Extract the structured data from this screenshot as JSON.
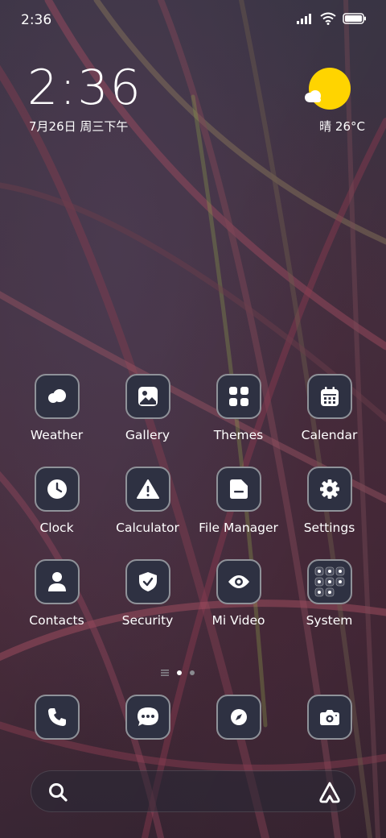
{
  "status_bar": {
    "time": "2:36",
    "icons": [
      "signal-icon",
      "wifi-icon",
      "battery-icon"
    ]
  },
  "lock_widget": {
    "big_time": "2:36",
    "date": "7月26日 周三下午"
  },
  "weather_widget": {
    "text": "晴 26°C",
    "icon": "sun-cloud-icon",
    "sun_color": "#ffd400"
  },
  "apps": [
    {
      "label": "Weather",
      "icon": "weather-cloud-icon"
    },
    {
      "label": "Gallery",
      "icon": "gallery-icon"
    },
    {
      "label": "Themes",
      "icon": "themes-grid-icon"
    },
    {
      "label": "Calendar",
      "icon": "calendar-icon"
    },
    {
      "label": "Clock",
      "icon": "clock-icon"
    },
    {
      "label": "Calculator",
      "icon": "calculator-warning-icon"
    },
    {
      "label": "File Manager",
      "icon": "folder-icon"
    },
    {
      "label": "Settings",
      "icon": "gear-icon"
    },
    {
      "label": "Contacts",
      "icon": "person-icon"
    },
    {
      "label": "Security",
      "icon": "shield-check-icon"
    },
    {
      "label": "Mi Video",
      "icon": "eye-icon"
    },
    {
      "label": "System",
      "icon": "system-folder-icon"
    }
  ],
  "page_indicator": {
    "pages": 2,
    "active": 1
  },
  "dock": [
    {
      "icon": "phone-icon"
    },
    {
      "icon": "messages-icon"
    },
    {
      "icon": "browser-compass-icon"
    },
    {
      "icon": "camera-icon"
    }
  ],
  "search_bar": {
    "left_icon": "search-icon",
    "right_icon": "assistant-icon"
  },
  "colors": {
    "icon_bg": "#2e3142",
    "icon_border": "#8f9299",
    "text": "#ffffff"
  }
}
